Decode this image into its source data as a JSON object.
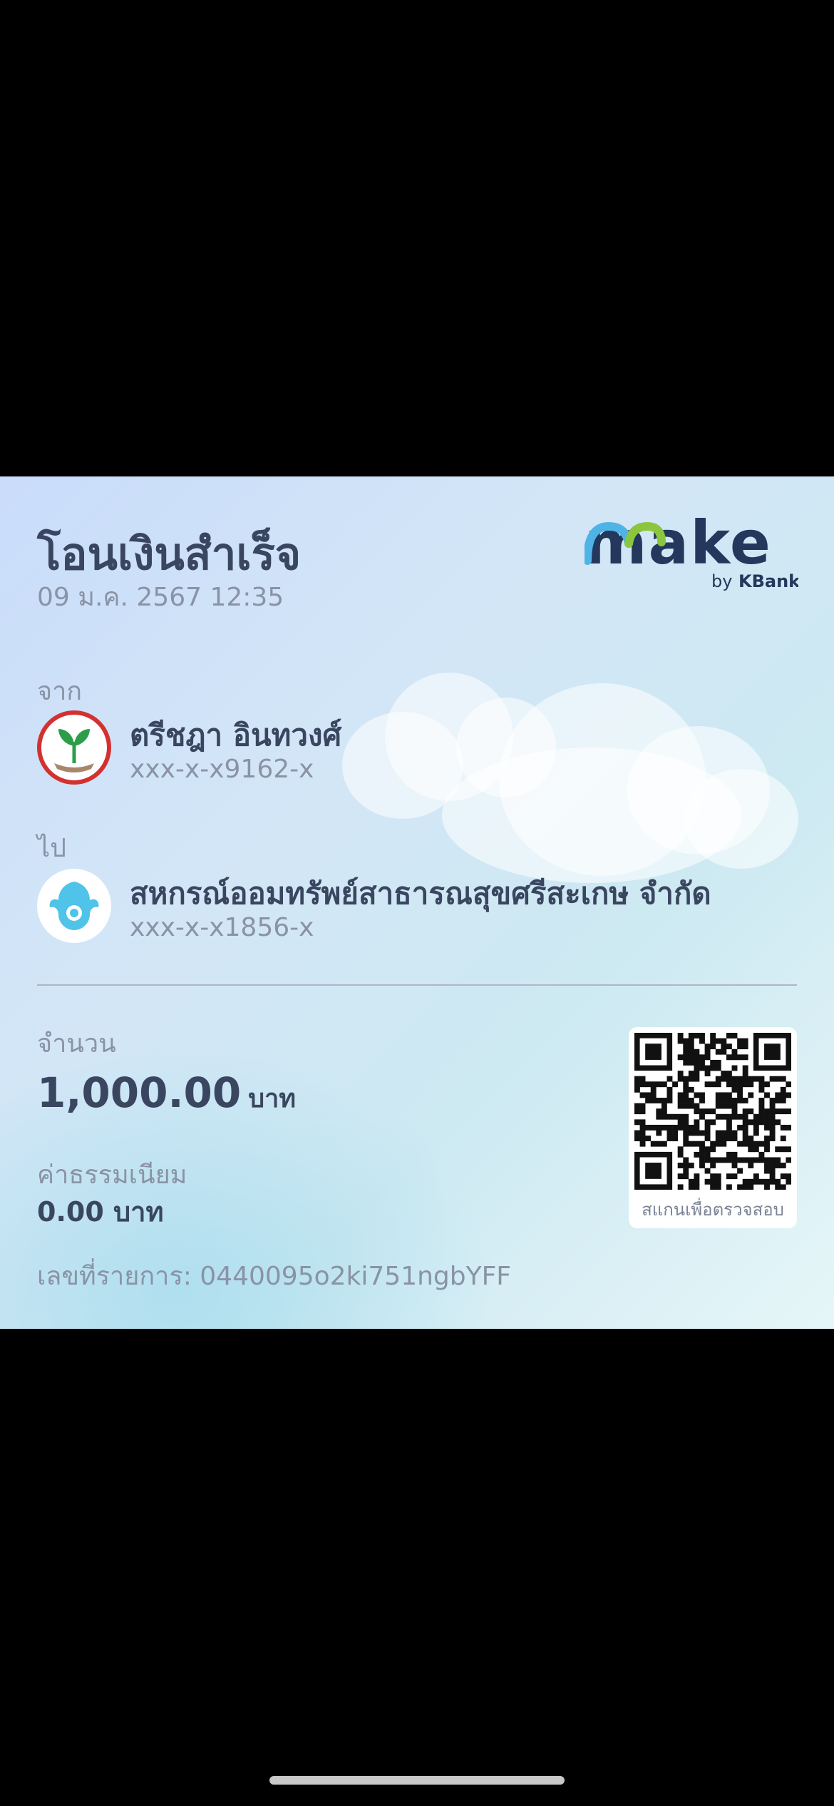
{
  "slip": {
    "title": "โอนเงินสำเร็จ",
    "datetime": "09 ม.ค. 2567 12:35",
    "logo_word": "make",
    "logo_by": "by",
    "logo_bank": "KBank",
    "from_label": "จาก",
    "from_name": "ตรีชฎา อินทวงศ์",
    "from_account": "xxx-x-x9162-x",
    "to_label": "ไป",
    "to_name": "สหกรณ์ออมทรัพย์สาธารณสุขศรีสะเกษ จำกัด",
    "to_account": "xxx-x-x1856-x",
    "amount_label": "จำนวน",
    "amount_value": "1,000.00",
    "amount_unit": "บาท",
    "fee_label": "ค่าธรรมเนียม",
    "fee_value": "0.00 บาท",
    "ref_text": "เลขที่รายการ: 0440095o2ki751ngbYFF",
    "qr_caption": "สแกนเพื่อตรวจสอบ"
  },
  "icons": {
    "from_bank": "kasikornbank-logo-icon",
    "to_bank": "krungthai-bank-logo-icon",
    "qr": "qr-code-icon"
  },
  "colors": {
    "title_text": "#3a4660",
    "muted_text": "#8a93a6",
    "logo_navy": "#23385c",
    "logo_green": "#8cc63f",
    "kbank_red": "#d3312f",
    "kbank_green": "#2e9d4a",
    "ktb_blue": "#4fc3e8"
  }
}
